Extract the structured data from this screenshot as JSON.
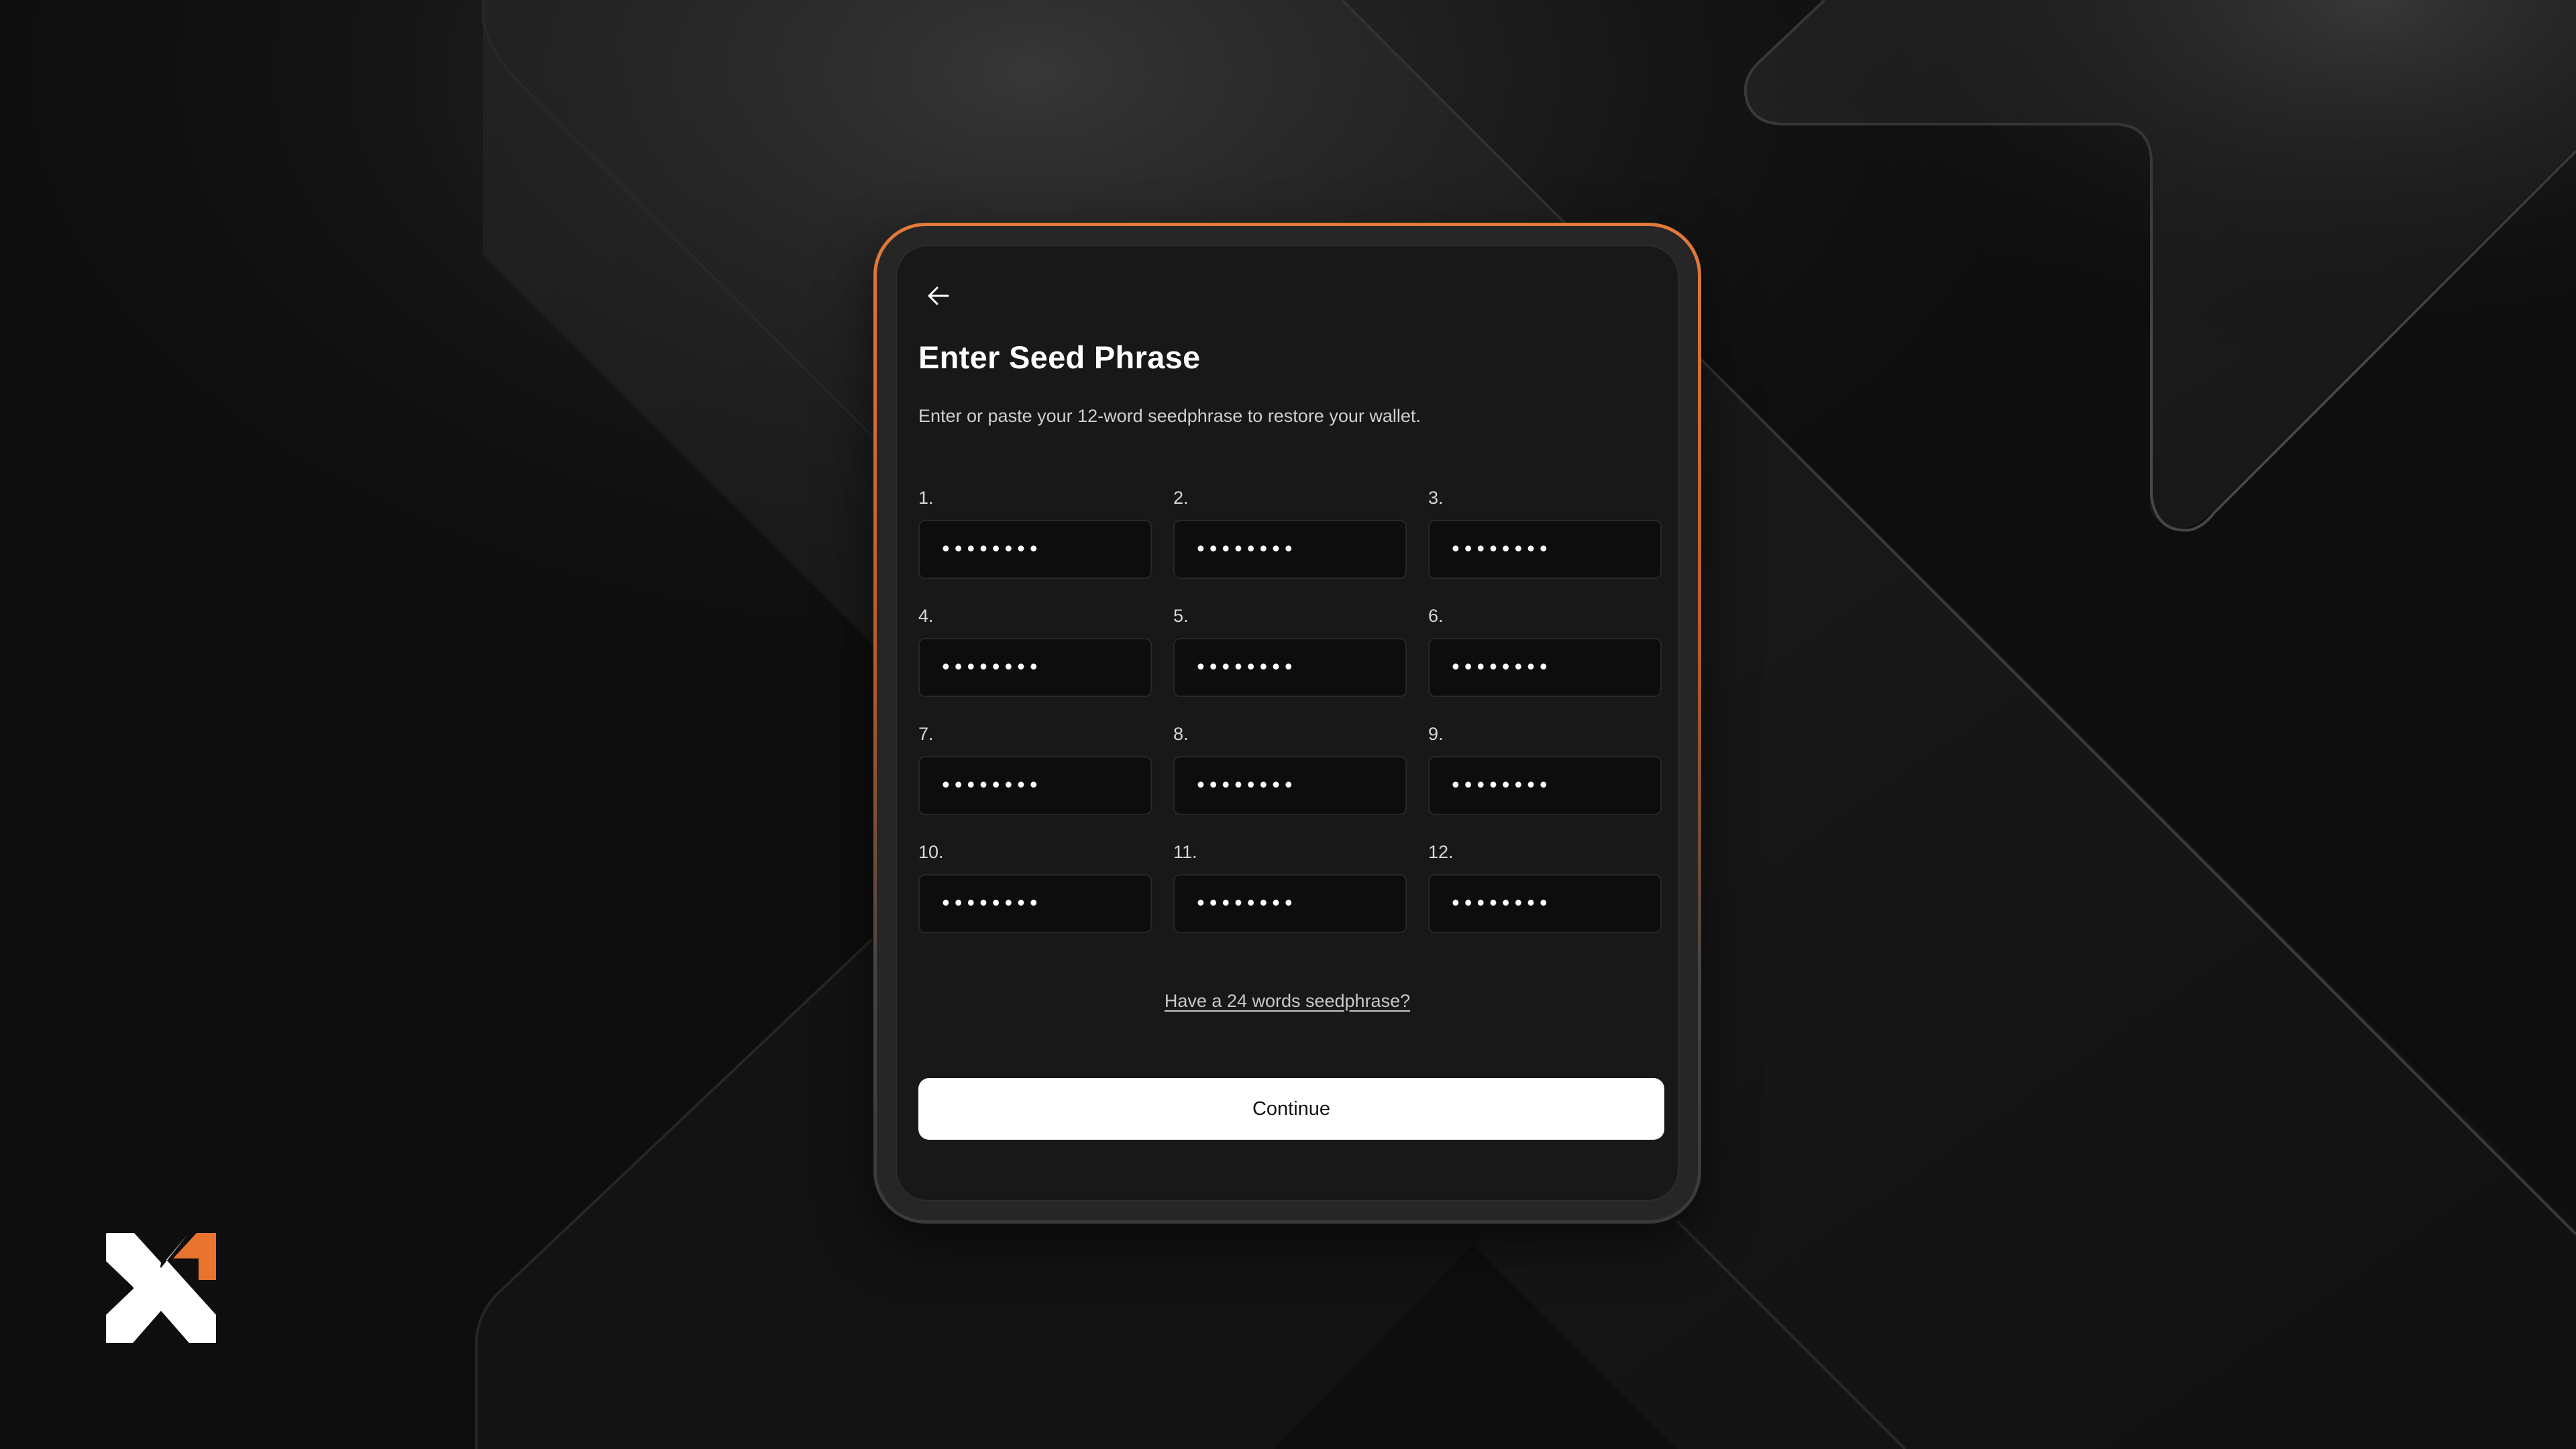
{
  "screen": {
    "title": "Enter Seed Phrase",
    "subtitle": "Enter or paste your 12-word seedphrase to restore your wallet.",
    "back_icon": "arrow-left-icon"
  },
  "seed_words": [
    {
      "label": "1.",
      "value": "••••••••"
    },
    {
      "label": "2.",
      "value": "••••••••"
    },
    {
      "label": "3.",
      "value": "••••••••"
    },
    {
      "label": "4.",
      "value": "••••••••"
    },
    {
      "label": "5.",
      "value": "••••••••"
    },
    {
      "label": "6.",
      "value": "••••••••"
    },
    {
      "label": "7.",
      "value": "••••••••"
    },
    {
      "label": "8.",
      "value": "••••••••"
    },
    {
      "label": "9.",
      "value": "••••••••"
    },
    {
      "label": "10.",
      "value": "••••••••"
    },
    {
      "label": "11.",
      "value": "••••••••"
    },
    {
      "label": "12.",
      "value": "••••••••"
    }
  ],
  "alt_link": "Have a 24 words seedphrase?",
  "continue_label": "Continue",
  "colors": {
    "accent": "#e8742f",
    "background": "#0d0d0d",
    "panel": "#181818",
    "input_bg": "#0d0d0d",
    "button_bg": "#ffffff"
  }
}
